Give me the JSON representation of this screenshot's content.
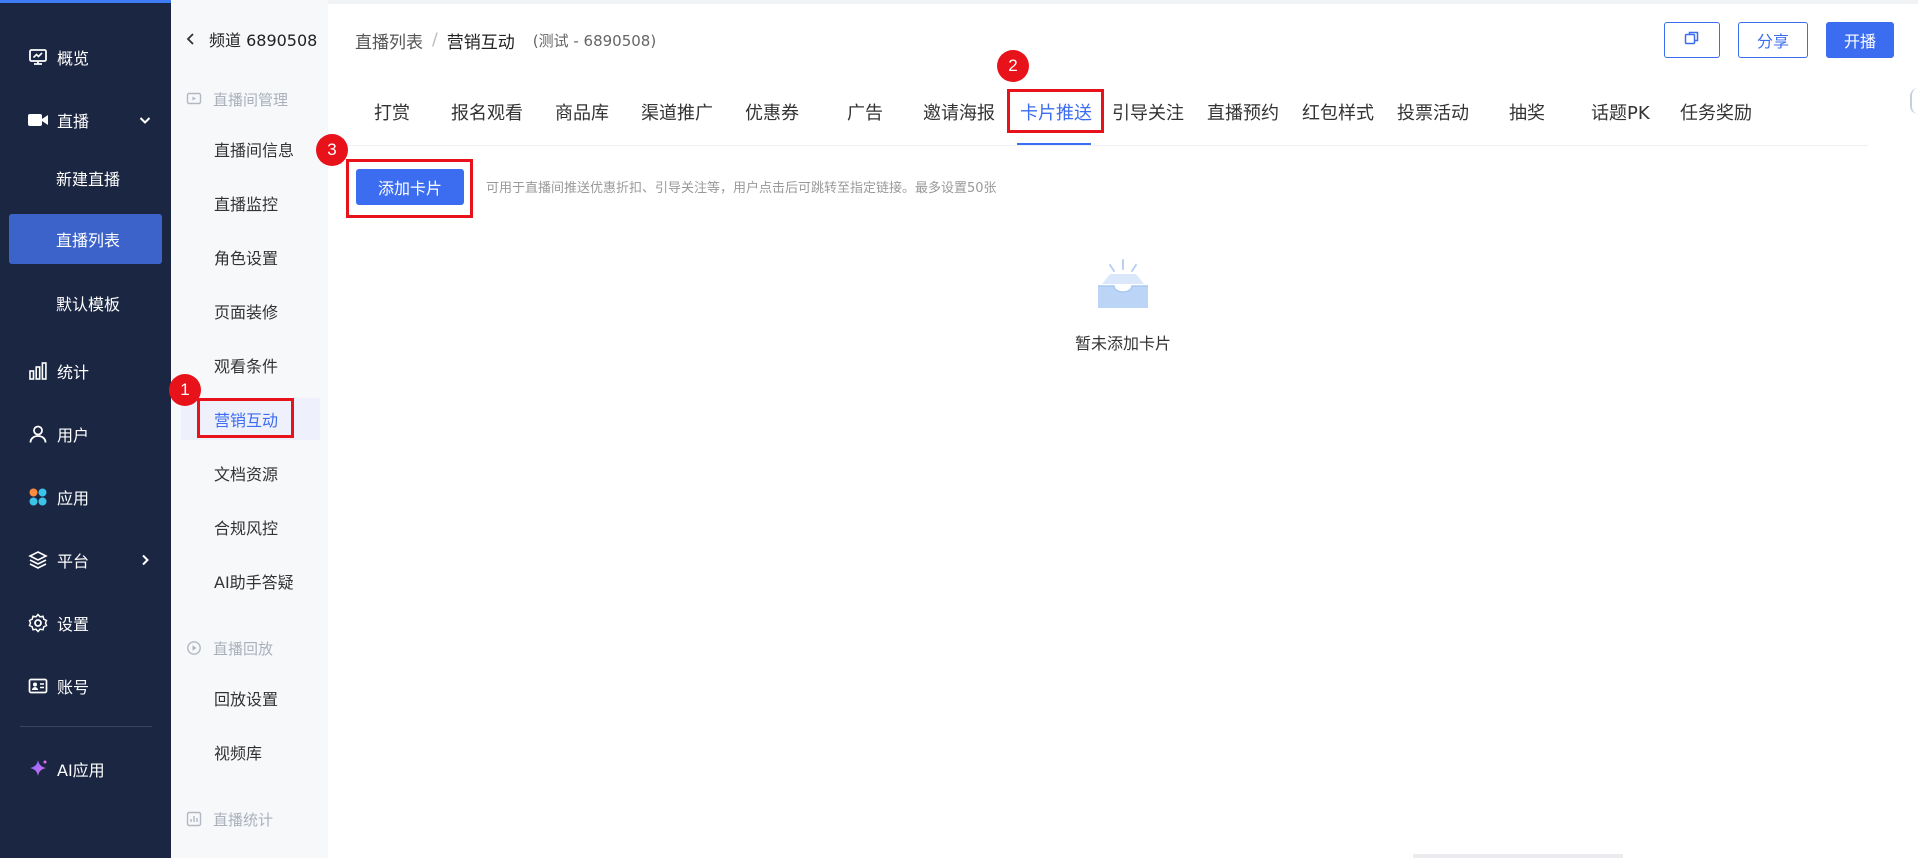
{
  "nav_primary": {
    "items": [
      {
        "label": "概览",
        "icon": "monitor-icon"
      },
      {
        "label": "直播",
        "icon": "video-icon"
      },
      {
        "label": "统计",
        "icon": "bar-chart-icon"
      },
      {
        "label": "用户",
        "icon": "user-icon"
      },
      {
        "label": "应用",
        "icon": "apps-icon"
      },
      {
        "label": "平台",
        "icon": "layers-icon"
      },
      {
        "label": "设置",
        "icon": "gear-icon"
      },
      {
        "label": "账号",
        "icon": "id-card-icon"
      },
      {
        "label": "AI应用",
        "icon": "sparkle-icon"
      }
    ],
    "live_sub": [
      {
        "label": "新建直播"
      },
      {
        "label": "直播列表",
        "active": true
      },
      {
        "label": "默认模板"
      }
    ]
  },
  "nav_secondary": {
    "channel": "频道 6890508",
    "groups": [
      {
        "title": "直播间管理",
        "icon": "room-icon",
        "items": [
          "直播间信息",
          "直播监控",
          "角色设置",
          "页面装修",
          "观看条件",
          "营销互动",
          "文档资源",
          "合规风控",
          "AI助手答疑"
        ]
      },
      {
        "title": "直播回放",
        "icon": "replay-icon",
        "items": [
          "回放设置",
          "视频库"
        ]
      },
      {
        "title": "直播统计",
        "icon": "stats-icon",
        "items": []
      }
    ],
    "active_item": "营销互动"
  },
  "breadcrumb": {
    "root": "直播列表",
    "current": "营销互动",
    "sub": "(测试 - 6890508)"
  },
  "header_actions": {
    "copy_icon": "copy-icon",
    "share": "分享",
    "go_live": "开播"
  },
  "tabs": [
    {
      "label": "打赏"
    },
    {
      "label": "报名观看"
    },
    {
      "label": "商品库"
    },
    {
      "label": "渠道推广"
    },
    {
      "label": "优惠券"
    },
    {
      "label": "广告"
    },
    {
      "label": "邀请海报"
    },
    {
      "label": "卡片推送",
      "active": true
    },
    {
      "label": "引导关注"
    },
    {
      "label": "直播预约"
    },
    {
      "label": "红包样式"
    },
    {
      "label": "投票活动"
    },
    {
      "label": "抽奖"
    },
    {
      "label": "话题PK"
    },
    {
      "label": "任务奖励"
    }
  ],
  "card_push": {
    "add_button": "添加卡片",
    "hint": "可用于直播间推送优惠折扣、引导关注等，用户点击后可跳转至指定链接。最多设置50张",
    "empty_text": "暂未添加卡片",
    "empty_icon": "empty-inbox-icon"
  },
  "annotations": [
    {
      "number": "1",
      "target": "营销互动"
    },
    {
      "number": "2",
      "target": "卡片推送"
    },
    {
      "number": "3",
      "target": "添加卡片"
    }
  ],
  "colors": {
    "nav_dark": "#1b2642",
    "accent": "#3c6df0",
    "annotation_red": "#e8131a"
  }
}
